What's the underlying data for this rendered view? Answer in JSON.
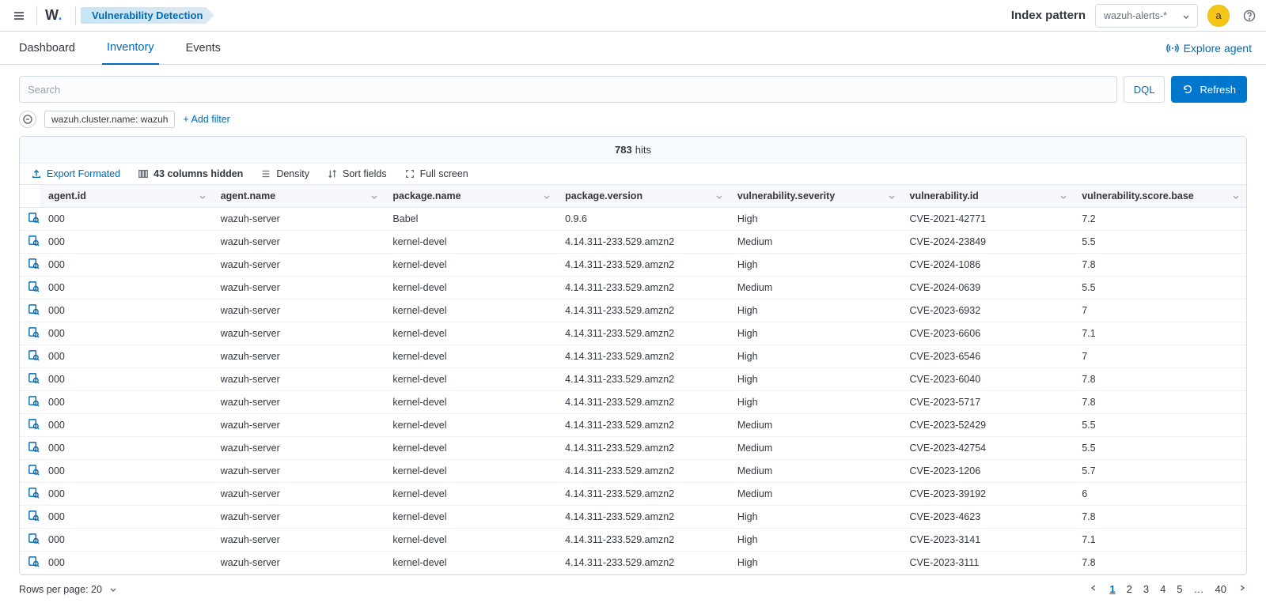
{
  "header": {
    "logo_text": "W",
    "breadcrumb": "Vulnerability Detection",
    "index_pattern_label": "Index pattern",
    "index_pattern_value": "wazuh-alerts-*",
    "avatar": "a"
  },
  "tabs": {
    "dashboard": "Dashboard",
    "inventory": "Inventory",
    "events": "Events",
    "explore_agent": "Explore agent"
  },
  "search": {
    "placeholder": "Search",
    "dql": "DQL",
    "refresh": "Refresh"
  },
  "filters": {
    "pill": "wazuh.cluster.name: wazuh",
    "add": "+ Add filter"
  },
  "hits": {
    "count": "783",
    "label": "hits"
  },
  "grid_toolbar": {
    "export": "Export Formated",
    "hidden_cols": "43 columns hidden",
    "density": "Density",
    "sort": "Sort fields",
    "fullscreen": "Full screen"
  },
  "columns": [
    "agent.id",
    "agent.name",
    "package.name",
    "package.version",
    "vulnerability.severity",
    "vulnerability.id",
    "vulnerability.score.base"
  ],
  "rows": [
    {
      "c": [
        "000",
        "wazuh-server",
        "Babel",
        "0.9.6",
        "High",
        "CVE-2021-42771",
        "7.2"
      ]
    },
    {
      "c": [
        "000",
        "wazuh-server",
        "kernel-devel",
        "4.14.311-233.529.amzn2",
        "Medium",
        "CVE-2024-23849",
        "5.5"
      ]
    },
    {
      "c": [
        "000",
        "wazuh-server",
        "kernel-devel",
        "4.14.311-233.529.amzn2",
        "High",
        "CVE-2024-1086",
        "7.8"
      ]
    },
    {
      "c": [
        "000",
        "wazuh-server",
        "kernel-devel",
        "4.14.311-233.529.amzn2",
        "Medium",
        "CVE-2024-0639",
        "5.5"
      ]
    },
    {
      "c": [
        "000",
        "wazuh-server",
        "kernel-devel",
        "4.14.311-233.529.amzn2",
        "High",
        "CVE-2023-6932",
        "7"
      ]
    },
    {
      "c": [
        "000",
        "wazuh-server",
        "kernel-devel",
        "4.14.311-233.529.amzn2",
        "High",
        "CVE-2023-6606",
        "7.1"
      ]
    },
    {
      "c": [
        "000",
        "wazuh-server",
        "kernel-devel",
        "4.14.311-233.529.amzn2",
        "High",
        "CVE-2023-6546",
        "7"
      ]
    },
    {
      "c": [
        "000",
        "wazuh-server",
        "kernel-devel",
        "4.14.311-233.529.amzn2",
        "High",
        "CVE-2023-6040",
        "7.8"
      ]
    },
    {
      "c": [
        "000",
        "wazuh-server",
        "kernel-devel",
        "4.14.311-233.529.amzn2",
        "High",
        "CVE-2023-5717",
        "7.8"
      ]
    },
    {
      "c": [
        "000",
        "wazuh-server",
        "kernel-devel",
        "4.14.311-233.529.amzn2",
        "Medium",
        "CVE-2023-52429",
        "5.5"
      ]
    },
    {
      "c": [
        "000",
        "wazuh-server",
        "kernel-devel",
        "4.14.311-233.529.amzn2",
        "Medium",
        "CVE-2023-42754",
        "5.5"
      ]
    },
    {
      "c": [
        "000",
        "wazuh-server",
        "kernel-devel",
        "4.14.311-233.529.amzn2",
        "Medium",
        "CVE-2023-1206",
        "5.7"
      ]
    },
    {
      "c": [
        "000",
        "wazuh-server",
        "kernel-devel",
        "4.14.311-233.529.amzn2",
        "Medium",
        "CVE-2023-39192",
        "6"
      ]
    },
    {
      "c": [
        "000",
        "wazuh-server",
        "kernel-devel",
        "4.14.311-233.529.amzn2",
        "High",
        "CVE-2023-4623",
        "7.8"
      ]
    },
    {
      "c": [
        "000",
        "wazuh-server",
        "kernel-devel",
        "4.14.311-233.529.amzn2",
        "High",
        "CVE-2023-3141",
        "7.1"
      ]
    },
    {
      "c": [
        "000",
        "wazuh-server",
        "kernel-devel",
        "4.14.311-233.529.amzn2",
        "High",
        "CVE-2023-3111",
        "7.8"
      ]
    }
  ],
  "footer": {
    "rpp_label": "Rows per page: 20",
    "pages": [
      "1",
      "2",
      "3",
      "4",
      "5",
      "…",
      "40"
    ]
  }
}
